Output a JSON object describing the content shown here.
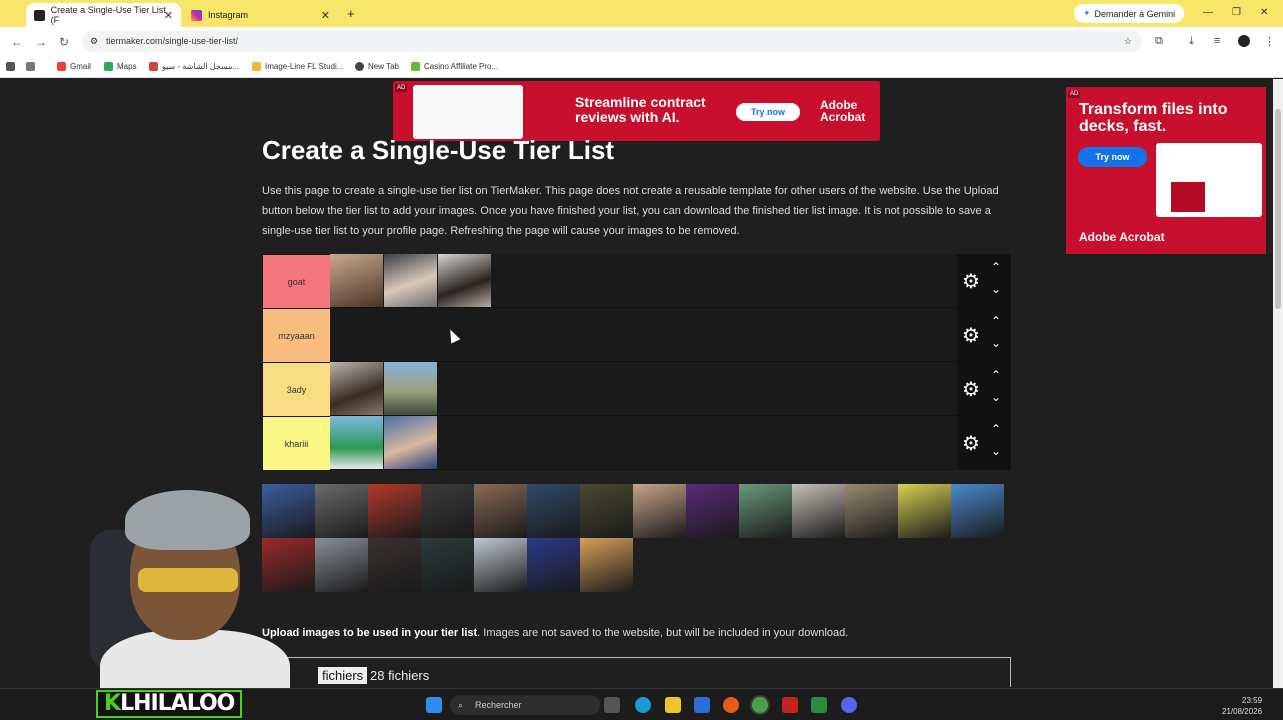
{
  "browser": {
    "tabs": [
      {
        "title": "Create a Single-Use Tier List (F",
        "active": true
      },
      {
        "title": "Instagram",
        "active": false
      }
    ],
    "new_tab": "+",
    "gemini_button": "Demander à Gemini",
    "url": "tiermaker.com/single-use-tier-list/",
    "bookmarks": [
      "Gmail",
      "Maps",
      "مسجل الشاشة - سيو...",
      "Image-Line FL Studi...",
      "New Tab",
      "Casino Affiliate Pro..."
    ]
  },
  "ads": {
    "top": {
      "tag": "AD",
      "headline": "Streamline contract reviews with AI.",
      "cta": "Try now",
      "brand": "Adobe Acrobat"
    },
    "side": {
      "tag": "AD",
      "headline": "Transform files into decks, fast.",
      "cta": "Try now",
      "brand": "Adobe Acrobat"
    }
  },
  "page": {
    "title": "Create a Single-Use Tier List",
    "description": "Use this page to create a single-use tier list on TierMaker. This page does not create a reusable template for other users of the website. Use the Upload button below the tier list to add your images. Once you have finished your list, you can download the finished tier list image. It is not possible to save a single-use tier list to your profile page. Refreshing the page will cause your images to be removed."
  },
  "tiers": [
    {
      "label": "goat",
      "color": "#f4777e",
      "items": 3
    },
    {
      "label": "mzyaaan",
      "color": "#f9bd7f",
      "items": 0
    },
    {
      "label": "3ady",
      "color": "#f9dd82",
      "items": 2
    },
    {
      "label": "khariii",
      "color": "#fbf784",
      "items": 2
    }
  ],
  "pool_count": 28,
  "upload": {
    "bold": "Upload images to be used in your tier list",
    "rest": ". Images are not saved to the website, but will be included in your download.",
    "button": "fichiers",
    "count": "28 fichiers"
  },
  "taskbar": {
    "search": "Rechercher",
    "time": "23:59",
    "date": "21/08/2026"
  },
  "overlay": {
    "prefix": "K",
    "name": "LHILALOO"
  }
}
